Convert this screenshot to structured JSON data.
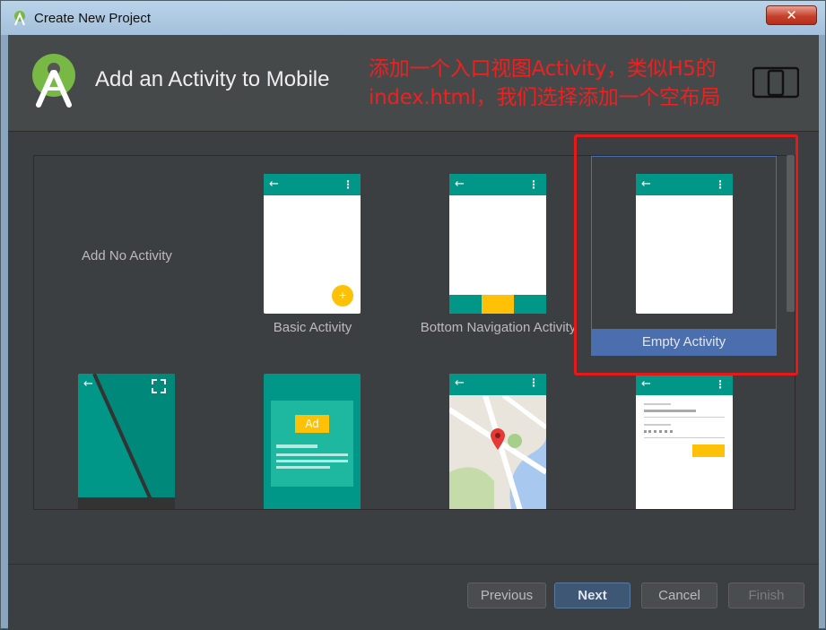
{
  "window": {
    "title": "Create New Project",
    "close_glyph": "✕"
  },
  "header": {
    "title": "Add an Activity to Mobile",
    "annotation": "添加一个入口视图Activity，类似H5的index.html，我们选择添加一个空布局",
    "device_icon": "phone-tablet-icon"
  },
  "templates": {
    "no_activity": "Add No Activity",
    "basic": "Basic Activity",
    "bottom_nav": "Bottom Navigation Activity",
    "empty": "Empty Activity",
    "fab_glyph": "+",
    "ad_label": "Ad",
    "selected": "Empty Activity"
  },
  "buttons": {
    "previous": "Previous",
    "next": "Next",
    "cancel": "Cancel",
    "finish": "Finish"
  },
  "colors": {
    "teal": "#009688",
    "accent": "#ffc107",
    "selection": "#4b6eaf",
    "annotation": "#ee2020"
  }
}
